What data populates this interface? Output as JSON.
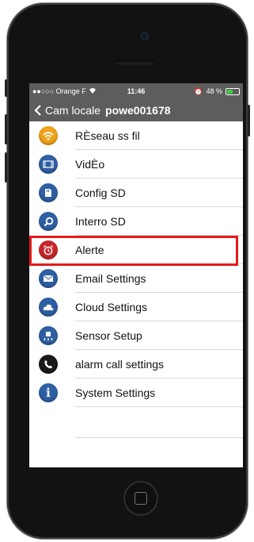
{
  "statusbar": {
    "carrier": "●●○○○ Orange F",
    "time": "11:46",
    "battery": "48 %",
    "battery_level": 0.48
  },
  "navbar": {
    "back_label": "Cam locale",
    "title": "powe001678"
  },
  "menu": [
    {
      "label": "RÈseau ss fil",
      "icon": "wifi-icon",
      "color": "#f0a21a"
    },
    {
      "label": "VidÈo",
      "icon": "video-icon",
      "color": "#2f5fa3"
    },
    {
      "label": "Config SD",
      "icon": "sd-card-icon",
      "color": "#2f5fa3"
    },
    {
      "label": "Interro SD",
      "icon": "search-icon",
      "color": "#2f5fa3"
    },
    {
      "label": "Alerte",
      "icon": "alarm-clock-icon",
      "color": "#c8262a"
    },
    {
      "label": "Email Settings",
      "icon": "email-icon",
      "color": "#2f5fa3"
    },
    {
      "label": "Cloud Settings",
      "icon": "cloud-icon",
      "color": "#2f5fa3"
    },
    {
      "label": "Sensor Setup",
      "icon": "sensor-icon",
      "color": "#2f5fa3"
    },
    {
      "label": "alarm call settings",
      "icon": "phone-icon",
      "color": "#1a1a1a"
    },
    {
      "label": "System Settings",
      "icon": "info-icon",
      "color": "#2f5fa3"
    }
  ],
  "highlighted_item": "Alerte",
  "highlight_color": "#e51a1a"
}
